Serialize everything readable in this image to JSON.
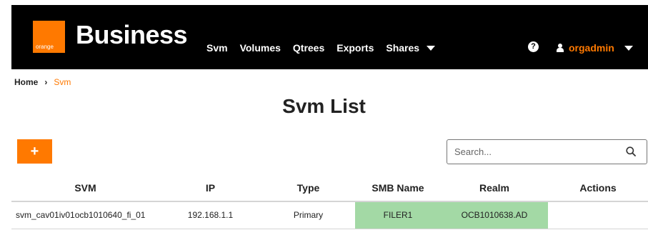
{
  "header": {
    "logo_text": "orange",
    "brand": "Business",
    "nav": [
      "Svm",
      "Volumes",
      "Qtrees",
      "Exports",
      "Shares"
    ],
    "help_symbol": "?",
    "user": "orgadmin"
  },
  "breadcrumb": {
    "home": "Home",
    "separator": "›",
    "current": "Svm"
  },
  "page": {
    "title": "Svm List",
    "add_label": "+"
  },
  "search": {
    "placeholder": "Search...",
    "value": ""
  },
  "table": {
    "columns": [
      "SVM",
      "IP",
      "Type",
      "SMB Name",
      "Realm",
      "Actions"
    ],
    "rows": [
      {
        "svm": "svm_cav01iv01ocb1010640_fi_01",
        "ip": "192.168.1.1",
        "type": "Primary",
        "smb_name": "FILER1",
        "realm": "OCB1010638.AD",
        "actions": ""
      }
    ]
  },
  "colors": {
    "accent": "#ff7900",
    "header_bg": "#000000",
    "highlight": "#a3d9a5"
  },
  "icons": {
    "search": "search-icon",
    "user": "user-icon",
    "help": "help-icon",
    "caret": "chevron-down-icon"
  }
}
